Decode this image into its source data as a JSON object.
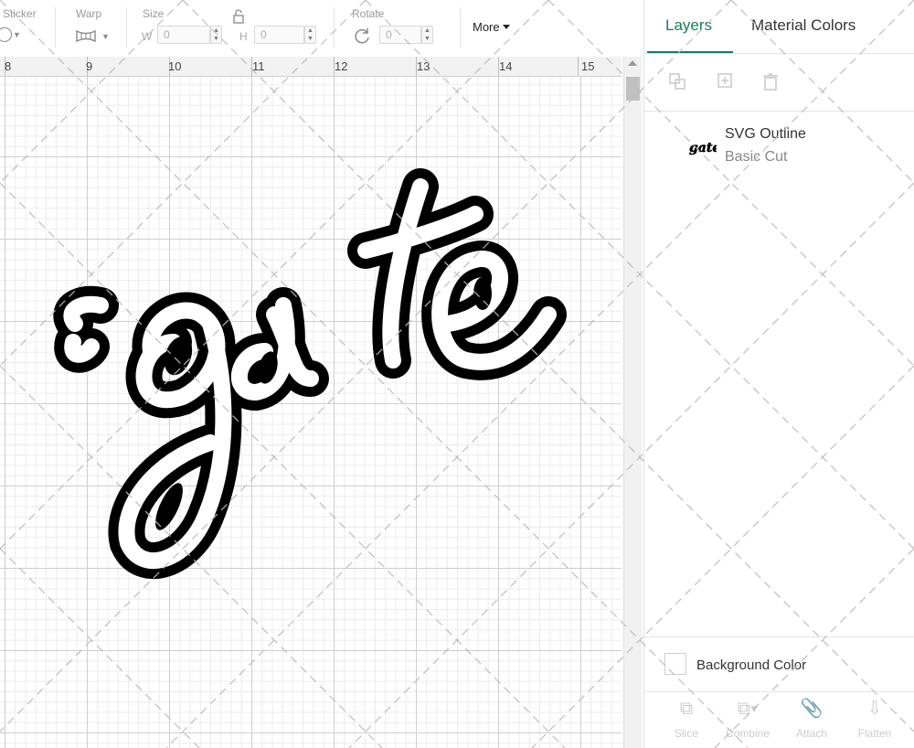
{
  "toolbar": {
    "sticker_label": "Sticker",
    "warp_label": "Warp",
    "size_label": "Size",
    "width_prefix": "W",
    "width_value": "0",
    "height_prefix": "H",
    "height_value": "0",
    "rotate_label": "Rotate",
    "rotate_value": "0",
    "more_label": "More"
  },
  "ruler": {
    "numbers": [
      "8",
      "9",
      "10",
      "11",
      "12",
      "13",
      "14",
      "15"
    ]
  },
  "canvas": {
    "artwork_text": "gate",
    "artwork_fill": "#000000",
    "artwork_inner": "#ffffff"
  },
  "panel": {
    "tabs": [
      {
        "label": "Layers",
        "active": true
      },
      {
        "label": "Material Colors",
        "active": false
      }
    ],
    "accent_color": "#1b7a52",
    "layer": {
      "name": "SVG Outline",
      "operation": "Basic Cut",
      "thumbnail_icon": "gate-thumbnail-icon"
    },
    "background_color_label": "Background Color",
    "bottom_tools": [
      "Slice",
      "Combine",
      "Attach",
      "Flatten"
    ]
  }
}
